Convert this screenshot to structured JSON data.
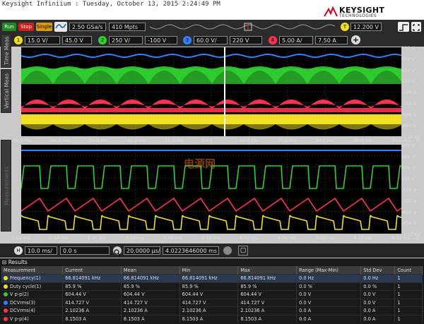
{
  "window": {
    "title": "Keysight Infiniium : Tuesday, October 13, 2015 2:24:49 PM"
  },
  "brand": {
    "name": "KEYSIGHT",
    "sub": "TECHNOLOGIES"
  },
  "toolbar": {
    "run": "Run",
    "stop": "Stop",
    "single": "Single",
    "sample_rate": "2.50 GSa/s",
    "memory": "410 Mpts",
    "trigger_level": "12.200 V",
    "trigger_chip": "T"
  },
  "channels": [
    {
      "num": "1",
      "scale": "15.0 V/",
      "offset": "45.0 V",
      "color": "#f0e020"
    },
    {
      "num": "2",
      "scale": "250 V/",
      "offset": "-100 V",
      "color": "#30d030"
    },
    {
      "num": "3",
      "scale": "60.0 V/",
      "offset": "220 V",
      "color": "#3080ff"
    },
    {
      "num": "4",
      "scale": "5.00 A/",
      "offset": "7.50 A",
      "color": "#ff3050"
    }
  ],
  "sidetabs": {
    "time_meas": "Time Meas",
    "vertical_meas": "Vertical Meas",
    "measurements": "Measurements"
  },
  "upper_axis": {
    "x_ticks": [
      "-50.0 ms",
      "-40.0 ms",
      "-30.0 ms",
      "-20.0 ms",
      "-10.0 ms",
      "0.0 s",
      "10.0 ms",
      "20.0 ms",
      "30.0 ms",
      "40.0 ms",
      "50.0 ms"
    ],
    "y_ticks": [
      "900 V",
      "650 V",
      "400 V",
      "150 V",
      "-100 V",
      "-350 V",
      "-600 V",
      "-850 V",
      "-1.10 kV"
    ],
    "right_index": "2"
  },
  "lower_axis": {
    "x_ticks": [
      "3.92 ms",
      "3.94 ms",
      "3.96 ms",
      "3.98 ms",
      "4.00 ms",
      "4.02 ms",
      "4.04 ms",
      "4.06 ms",
      "4.08 ms",
      "4.10 ms",
      "4.12 ms"
    ],
    "y_ticks": [
      "900 V",
      "650 V",
      "400 V",
      "150 V",
      "-100 V",
      "-350 V",
      "-600 V",
      "-850 V",
      "-1.10 kV"
    ],
    "right_index": "2"
  },
  "watermark": "电源网",
  "horizontal": {
    "chip": "H",
    "scale": "10.0 ms/",
    "position": "0.0 s",
    "zoom_scale": "20.0000 µs/",
    "zoom_position": "4.0223646000 ms"
  },
  "results": {
    "title": "Results",
    "columns": [
      "Measurement",
      "Current",
      "Mean",
      "Min",
      "Max",
      "Range (Max-Min)",
      "Std Dev",
      "Count"
    ],
    "rows": [
      {
        "name": "Frequency(1)",
        "current": "66.814091 kHz",
        "mean": "66.814091 kHz",
        "min": "66.814091 kHz",
        "max": "66.814091 kHz",
        "range": "0.0 Hz",
        "std": "0.0 Hz",
        "count": "1",
        "color": "#f0e020"
      },
      {
        "name": "Duty cycle(1)",
        "current": "85.9 %",
        "mean": "85.9 %",
        "min": "85.9 %",
        "max": "85.9 %",
        "range": "0.0 %",
        "std": "0.0 %",
        "count": "1",
        "color": "#f0e020"
      },
      {
        "name": "V p-p(2)",
        "current": "604.44 V",
        "mean": "604.44 V",
        "min": "604.44 V",
        "max": "604.44 V",
        "range": "0.0 V",
        "std": "0.0 V",
        "count": "1",
        "color": "#30d030"
      },
      {
        "name": "DCVrms(3)",
        "current": "414.727 V",
        "mean": "414.727 V",
        "min": "414.727 V",
        "max": "414.727 V",
        "range": "0.0 V",
        "std": "0.0 V",
        "count": "1",
        "color": "#3080ff"
      },
      {
        "name": "DCVrms(4)",
        "current": "2.10236 A",
        "mean": "2.10236 A",
        "min": "2.10236 A",
        "max": "2.10236 A",
        "range": "0.0 A",
        "std": "0.0 A",
        "count": "1",
        "color": "#ff3050"
      },
      {
        "name": "V p-p(4)",
        "current": "8.1503 A",
        "mean": "8.1503 A",
        "min": "8.1503 A",
        "max": "8.1503 A",
        "range": "0.0 A",
        "std": "0.0 A",
        "count": "1",
        "color": "#ff3050"
      }
    ]
  }
}
